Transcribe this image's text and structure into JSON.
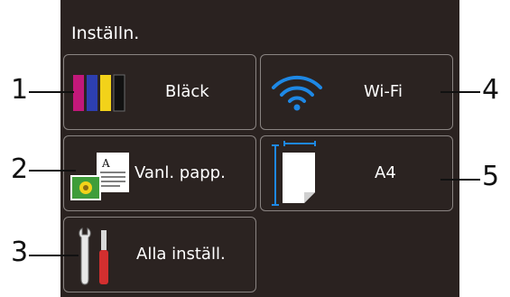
{
  "screen": {
    "title": "Inställn."
  },
  "tiles": {
    "ink": {
      "label": "Bläck"
    },
    "wifi": {
      "label": "Wi-Fi"
    },
    "paper": {
      "label": "Vanl. papp."
    },
    "papersize": {
      "label": "A4"
    },
    "allsettings": {
      "label": "Alla inställ."
    }
  },
  "callouts": [
    "1",
    "2",
    "3",
    "4",
    "5"
  ],
  "colors": {
    "screen_bg": "#2a2220",
    "tile_border": "#8a8482",
    "wifi_blue": "#1e88e5",
    "ink_magenta": "#c2187a",
    "ink_cyan": "#2d3fb0",
    "ink_yellow": "#f2d21a",
    "ink_black": "#111111"
  },
  "icons": [
    "ink-cartridges-icon",
    "wifi-icon",
    "paper-photo-icon",
    "paper-size-icon",
    "tools-icon"
  ]
}
